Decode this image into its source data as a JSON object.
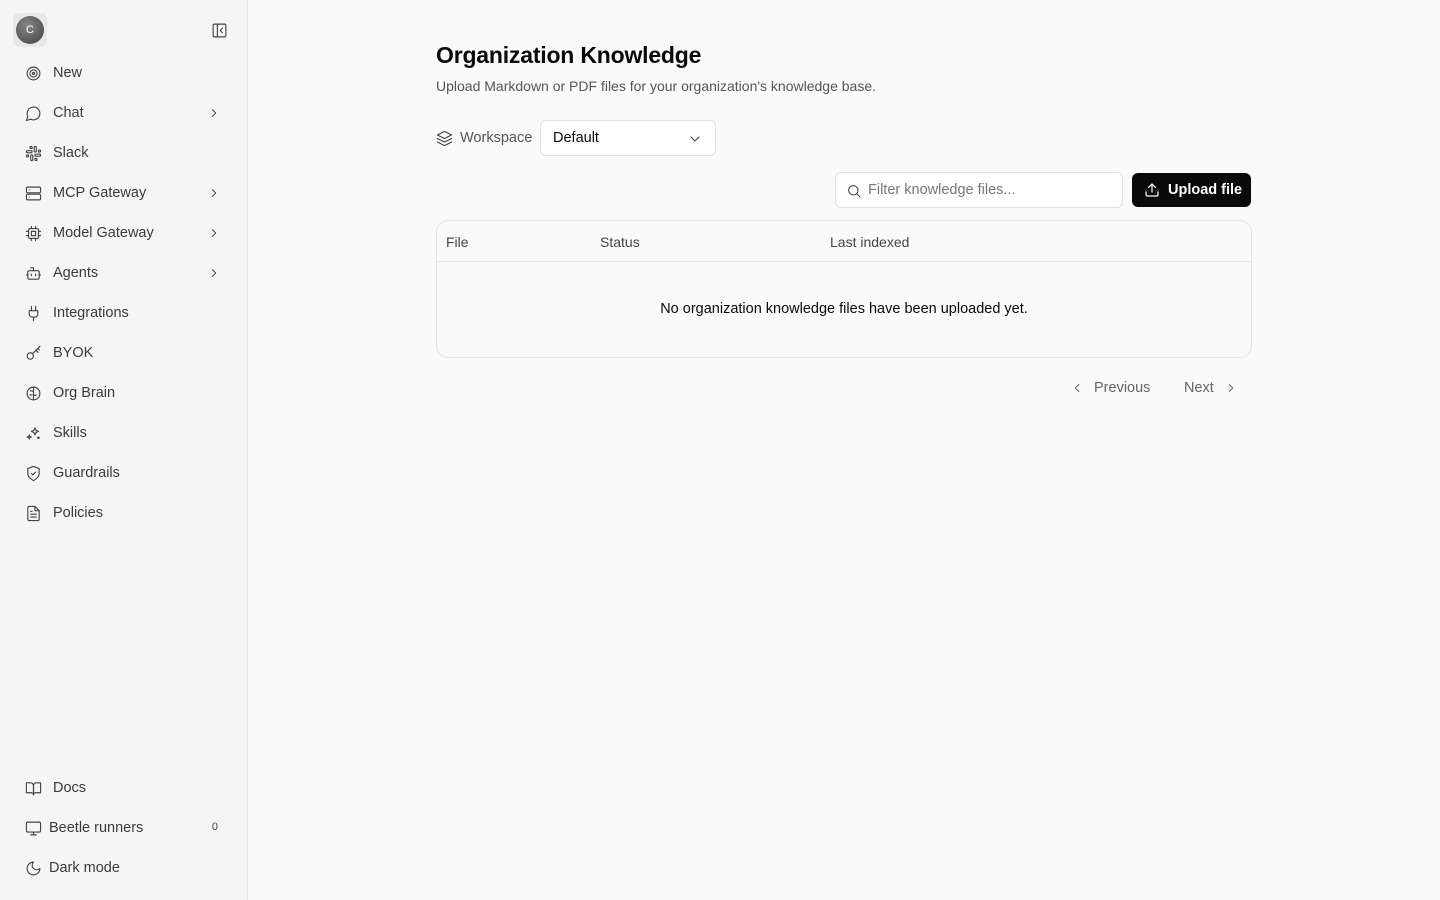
{
  "sidebar": {
    "avatar_initial": "C",
    "nav": [
      {
        "label": "New",
        "icon": "target-icon",
        "has_chevron": false
      },
      {
        "label": "Chat",
        "icon": "chat-bubble-icon",
        "has_chevron": true
      },
      {
        "label": "Slack",
        "icon": "slack-icon",
        "has_chevron": false
      },
      {
        "label": "MCP Gateway",
        "icon": "server-icon",
        "has_chevron": true
      },
      {
        "label": "Model Gateway",
        "icon": "cpu-icon",
        "has_chevron": true
      },
      {
        "label": "Agents",
        "icon": "bot-icon",
        "has_chevron": true
      },
      {
        "label": "Integrations",
        "icon": "plug-icon",
        "has_chevron": false
      },
      {
        "label": "BYOK",
        "icon": "key-icon",
        "has_chevron": false
      },
      {
        "label": "Org Brain",
        "icon": "brain-icon",
        "has_chevron": false
      },
      {
        "label": "Skills",
        "icon": "sparkles-icon",
        "has_chevron": false
      },
      {
        "label": "Guardrails",
        "icon": "shield-check-icon",
        "has_chevron": false
      },
      {
        "label": "Policies",
        "icon": "file-text-icon",
        "has_chevron": false
      }
    ],
    "footer": [
      {
        "label": "Docs",
        "icon": "book-open-icon"
      },
      {
        "label": "Beetle runners",
        "icon": "monitor-icon",
        "count": "0"
      },
      {
        "label": "Dark mode",
        "icon": "moon-icon"
      }
    ]
  },
  "main": {
    "title": "Organization Knowledge",
    "subtitle": "Upload Markdown or PDF files for your organization's knowledge base.",
    "workspace_label": "Workspace",
    "workspace_value": "Default",
    "search_placeholder": "Filter knowledge files...",
    "upload_label": "Upload file",
    "table": {
      "columns": [
        "File",
        "Status",
        "Last indexed"
      ],
      "empty_message": "No organization knowledge files have been uploaded yet."
    },
    "pagination": {
      "previous": "Previous",
      "next": "Next"
    }
  }
}
